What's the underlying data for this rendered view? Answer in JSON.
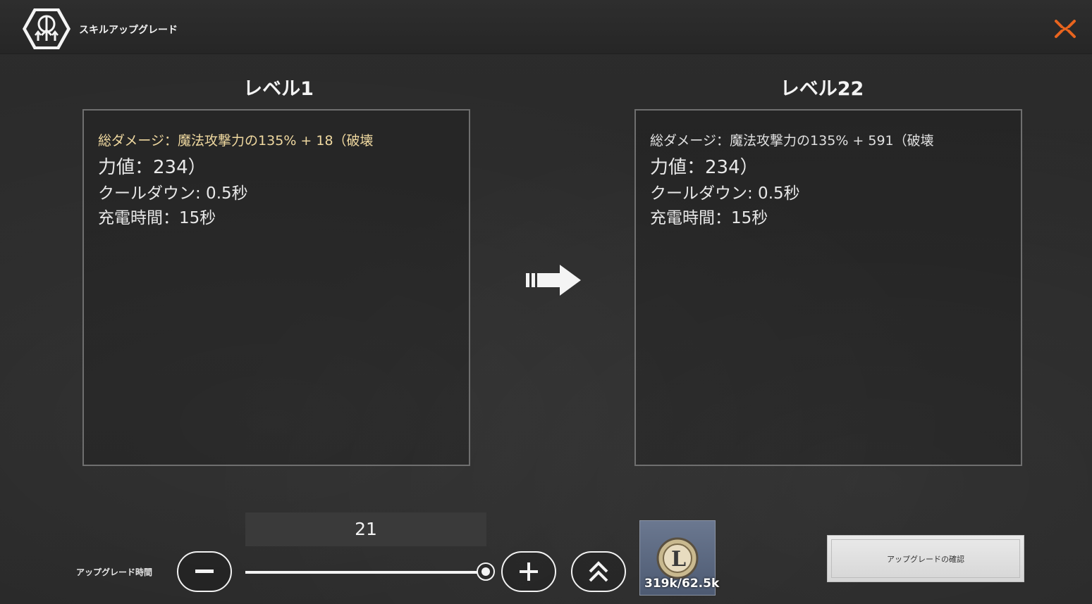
{
  "header": {
    "title": "スキルアップグレード",
    "emblem_icon": "skill-upgrade-emblem-icon",
    "close_icon": "close-icon",
    "close_color": "#e8641e"
  },
  "current": {
    "level_label": "レベル1",
    "damage_line": "総ダメージ：魔法攻撃力の135% + 18（破壊",
    "damage_color": "#f0d9a0",
    "power_line": "力値：234）",
    "cooldown_line": "クールダウン: 0.5秒",
    "charge_line": "充電時間：15秒"
  },
  "next": {
    "level_label": "レベル22",
    "damage_line": "総ダメージ：魔法攻撃力の135% + 591（破壊",
    "power_line": "力値：234）",
    "cooldown_line": "クールダウン: 0.5秒",
    "charge_line": "充電時間：15秒"
  },
  "controls": {
    "upgrade_count": "21",
    "time_label": "アップグレード時間",
    "minus_icon": "minus-icon",
    "plus_icon": "plus-icon",
    "max_icon": "double-chevron-up-icon",
    "slider_fraction": 1.0
  },
  "material": {
    "icon": "gold-coin-icon",
    "count": "319k/62.5k"
  },
  "confirm": {
    "label": "アップグレードの確認"
  }
}
